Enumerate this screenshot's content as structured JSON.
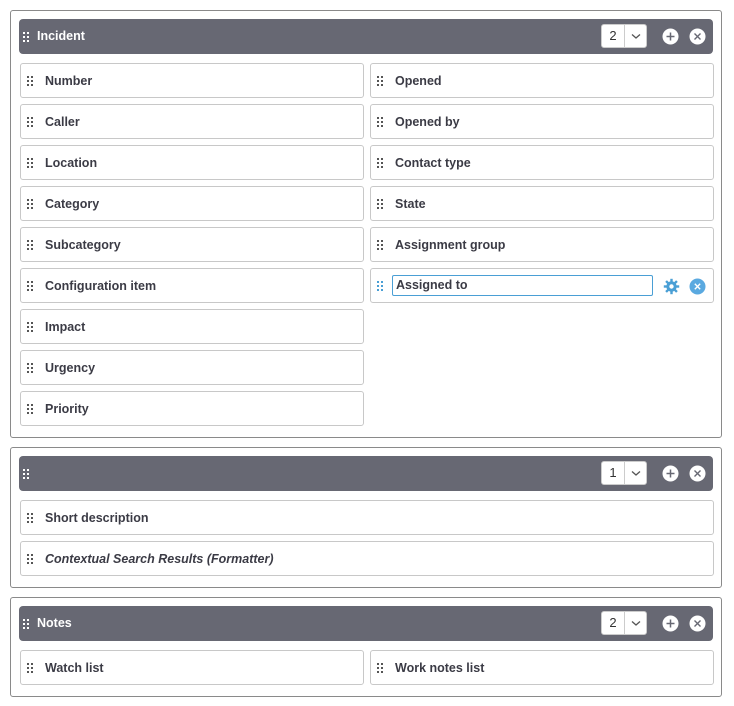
{
  "sections": [
    {
      "title": "Incident",
      "columns": "2",
      "left_fields": [
        "Number",
        "Caller",
        "Location",
        "Category",
        "Subcategory",
        "Configuration item",
        "Impact",
        "Urgency",
        "Priority"
      ],
      "right_fields": [
        "Opened",
        "Opened by",
        "Contact type",
        "State",
        "Assignment group"
      ],
      "editing_field": "Assigned to"
    },
    {
      "title": "",
      "columns": "1",
      "fields": [
        "Short description",
        "Contextual Search Results (Formatter)"
      ]
    },
    {
      "title": "Notes",
      "columns": "2",
      "left_fields": [
        "Watch list"
      ],
      "right_fields": [
        "Work notes list"
      ]
    }
  ],
  "colors": {
    "header_bg": "#676873",
    "field_border": "#c8c8c8",
    "edit_accent": "#4a9fd5"
  },
  "icons": {
    "grip": "drag-handle-icon",
    "add": "add-circle-icon",
    "remove": "close-circle-icon",
    "gear": "gear-icon",
    "chevron": "chevron-down-icon"
  }
}
